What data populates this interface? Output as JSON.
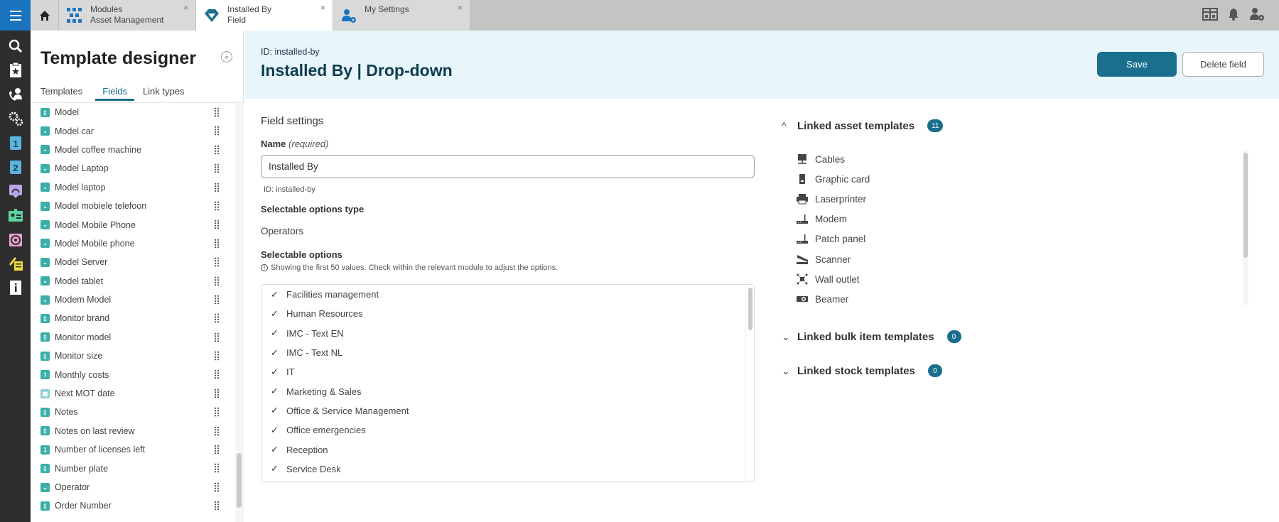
{
  "topbar": {
    "tabs": [
      {
        "line1": "Modules",
        "line2": "Asset Management",
        "icon": "modules-grid-icon",
        "active": false
      },
      {
        "line1": "Installed By",
        "line2": "Field",
        "icon": "diamond-icon",
        "active": true
      },
      {
        "line1": "My Settings",
        "line2": "",
        "icon": "user-settings-icon",
        "active": false
      }
    ],
    "close_glyph": "×",
    "right_icons": [
      "calendar-board-icon",
      "bell-icon",
      "user-settings-icon"
    ]
  },
  "rail": {
    "icons": [
      "search-icon",
      "starred-clipboard-icon",
      "phone-user-icon",
      "gears-icon",
      "line-1-icon",
      "line-2-icon",
      "dashboard-icon",
      "id-card-icon",
      "target-calendar-icon",
      "rocket-list-icon",
      "info-book-icon"
    ]
  },
  "left_panel": {
    "title": "Template designer",
    "collapse_glyph": "«",
    "tabs": [
      {
        "label": "Templates",
        "active": false
      },
      {
        "label": "Fields",
        "active": true
      },
      {
        "label": "Link types",
        "active": false
      }
    ],
    "fields": [
      {
        "label": "Model",
        "type": "text"
      },
      {
        "label": "Model car",
        "type": "dropdown"
      },
      {
        "label": "Model coffee machine",
        "type": "dropdown"
      },
      {
        "label": "Model Laptop",
        "type": "dropdown"
      },
      {
        "label": "Model laptop",
        "type": "dropdown"
      },
      {
        "label": "Model mobiele telefoon",
        "type": "dropdown"
      },
      {
        "label": "Model Mobile Phone",
        "type": "dropdown"
      },
      {
        "label": "Model Mobile phone",
        "type": "dropdown"
      },
      {
        "label": "Model Server",
        "type": "dropdown"
      },
      {
        "label": "Model tablet",
        "type": "dropdown"
      },
      {
        "label": "Modem Model",
        "type": "dropdown"
      },
      {
        "label": "Monitor brand",
        "type": "text"
      },
      {
        "label": "Monitor model",
        "type": "text"
      },
      {
        "label": "Monitor size",
        "type": "text"
      },
      {
        "label": "Monthly costs",
        "type": "number"
      },
      {
        "label": "Next MOT date",
        "type": "date"
      },
      {
        "label": "Notes",
        "type": "text"
      },
      {
        "label": "Notes on last review",
        "type": "text"
      },
      {
        "label": "Number of licenses left",
        "type": "number"
      },
      {
        "label": "Number plate",
        "type": "text"
      },
      {
        "label": "Operator",
        "type": "dropdown"
      },
      {
        "label": "Order Number",
        "type": "text"
      }
    ]
  },
  "header": {
    "id_line": "ID: installed-by",
    "title": "Installed By | Drop-down",
    "save_label": "Save",
    "delete_label": "Delete field"
  },
  "field_settings": {
    "section_title": "Field settings",
    "name_label": "Name",
    "name_required": "(required)",
    "name_value": "Installed By",
    "name_id": "ID: installed-by",
    "options_type_label": "Selectable options type",
    "options_type_value": "Operators",
    "options_label": "Selectable options",
    "options_note": "Showing the first 50 values. Check within the relevant module to adjust the options.",
    "options": [
      "Facilities management",
      "Human Resources",
      "IMC - Text EN",
      "IMC - Text NL",
      "IT",
      "Marketing & Sales",
      "Office & Service Management",
      "Office emergencies",
      "Reception",
      "Service Desk"
    ]
  },
  "linked": {
    "asset": {
      "title": "Linked asset templates",
      "count": "11",
      "expanded": true,
      "items": [
        {
          "label": "Cables",
          "icon": "cables-icon"
        },
        {
          "label": "Graphic card",
          "icon": "graphic-card-icon"
        },
        {
          "label": "Laserprinter",
          "icon": "printer-icon"
        },
        {
          "label": "Modem",
          "icon": "modem-icon"
        },
        {
          "label": "Patch panel",
          "icon": "patch-panel-icon"
        },
        {
          "label": "Scanner",
          "icon": "scanner-icon"
        },
        {
          "label": "Wall outlet",
          "icon": "wall-outlet-icon"
        },
        {
          "label": "Beamer",
          "icon": "beamer-icon"
        }
      ]
    },
    "bulk": {
      "title": "Linked bulk item templates",
      "count": "0",
      "expanded": false
    },
    "stock": {
      "title": "Linked stock templates",
      "count": "0",
      "expanded": false
    }
  }
}
